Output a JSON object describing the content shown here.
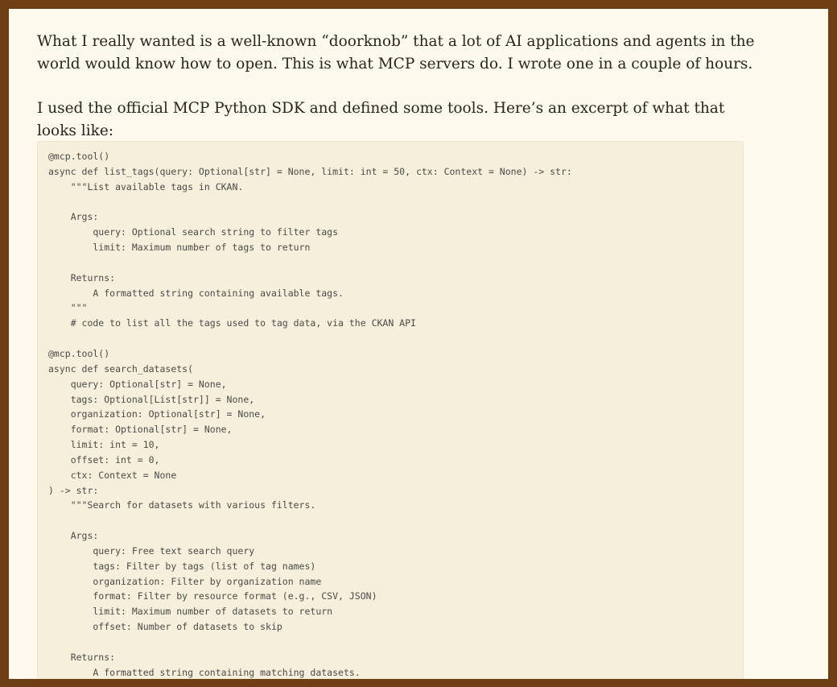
{
  "article": {
    "paragraph_1": "What I really wanted is a well-known “doorknob” that a lot of AI applications and agents in the world would know how to open. This is what MCP servers do. I wrote one in a couple of hours.",
    "paragraph_2": "I used the official MCP Python SDK and defined some tools. Here’s an excerpt of what that looks like:",
    "code": "@mcp.tool()\nasync def list_tags(query: Optional[str] = None, limit: int = 50, ctx: Context = None) -> str:\n    \"\"\"List available tags in CKAN.\n\n    Args:\n        query: Optional search string to filter tags\n        limit: Maximum number of tags to return\n\n    Returns:\n        A formatted string containing available tags.\n    \"\"\"\n    # code to list all the tags used to tag data, via the CKAN API\n\n@mcp.tool()\nasync def search_datasets(\n    query: Optional[str] = None,\n    tags: Optional[List[str]] = None,\n    organization: Optional[str] = None,\n    format: Optional[str] = None,\n    limit: int = 10,\n    offset: int = 0,\n    ctx: Context = None\n) -> str:\n    \"\"\"Search for datasets with various filters.\n\n    Args:\n        query: Free text search query\n        tags: Filter by tags (list of tag names)\n        organization: Filter by organization name\n        format: Filter by resource format (e.g., CSV, JSON)\n        limit: Maximum number of datasets to return\n        offset: Number of datasets to skip\n\n    Returns:\n        A formatted string containing matching datasets."
  }
}
